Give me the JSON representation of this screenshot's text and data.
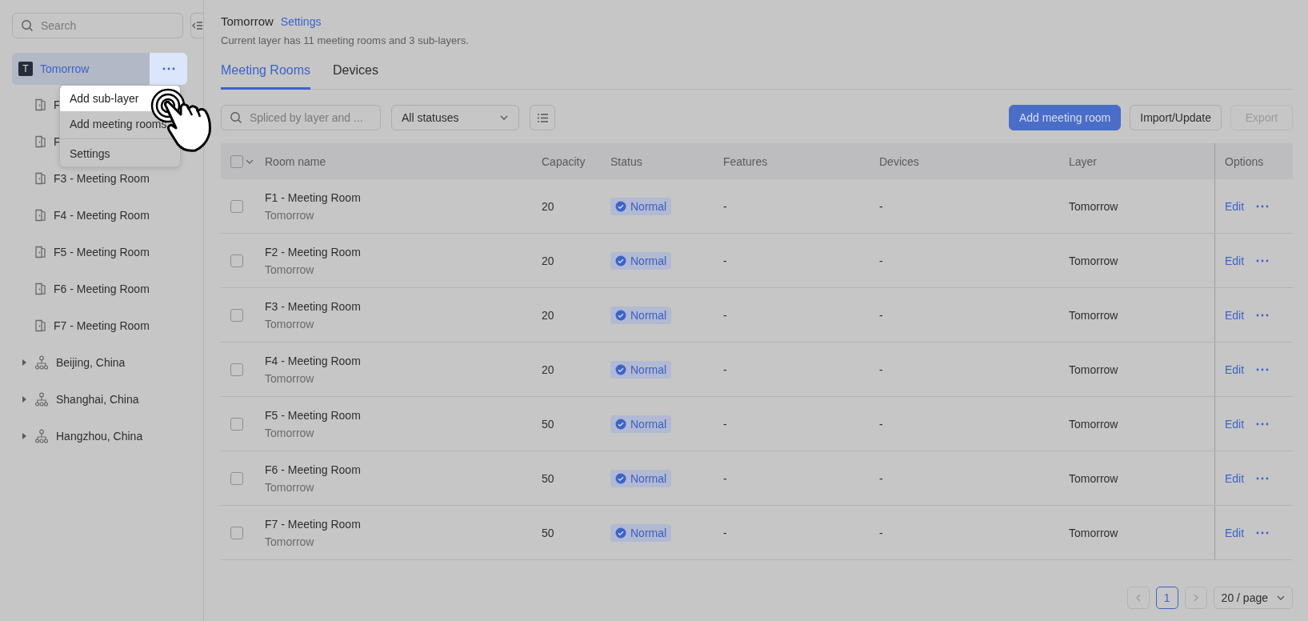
{
  "sidebar": {
    "search": {
      "placeholder": "Search"
    },
    "tree": [
      {
        "label": "Tomorrow",
        "badge": "T",
        "kind": "layer",
        "selected": true,
        "expanded": true,
        "children": [
          {
            "label": "F",
            "kind": "room"
          },
          {
            "label": "F",
            "kind": "room"
          },
          {
            "label": "F3 - Meeting Room",
            "kind": "room"
          },
          {
            "label": "F4 - Meeting Room",
            "kind": "room"
          },
          {
            "label": "F5 - Meeting Room",
            "kind": "room"
          },
          {
            "label": "F6 - Meeting Room",
            "kind": "room"
          },
          {
            "label": "F7 - Meeting Room",
            "kind": "room"
          }
        ]
      },
      {
        "label": "Beijing, China",
        "kind": "group",
        "selected": false,
        "expanded": false
      },
      {
        "label": "Shanghai, China",
        "kind": "group",
        "selected": false,
        "expanded": false
      },
      {
        "label": "Hangzhou, China",
        "kind": "group",
        "selected": false,
        "expanded": false
      }
    ]
  },
  "context_menu": {
    "items": [
      {
        "label": "Add sub-layer",
        "selected": true
      },
      {
        "label": "Add meeting rooms",
        "selected": false
      },
      {
        "label": "Settings",
        "selected": false
      }
    ]
  },
  "header": {
    "title": "Tomorrow",
    "settings_link": "Settings",
    "summary": "Current layer has 11 meeting rooms and 3 sub-layers."
  },
  "tabs": [
    {
      "label": "Meeting Rooms",
      "selected": true
    },
    {
      "label": "Devices",
      "selected": false
    }
  ],
  "toolbar": {
    "search": {
      "placeholder": "Spliced by layer and ..."
    },
    "status_filter": "All statuses",
    "buttons": [
      {
        "label": "Add meeting room",
        "kind": "primary",
        "disabled": false
      },
      {
        "label": "Import/Update",
        "kind": "default",
        "disabled": false
      },
      {
        "label": "Export",
        "kind": "default",
        "disabled": true
      }
    ]
  },
  "table": {
    "all_checked": false,
    "columns": [
      "Room name",
      "Capacity",
      "Status",
      "Features",
      "Devices",
      "Layer",
      "Options"
    ],
    "rows": [
      {
        "checked": false,
        "name": "F1 - Meeting Room",
        "layer_path": "Tomorrow",
        "capacity": "20",
        "status": "Normal",
        "features": "-",
        "devices": "-",
        "layer": "Tomorrow",
        "action": "Edit"
      },
      {
        "checked": false,
        "name": "F2 - Meeting Room",
        "layer_path": "Tomorrow",
        "capacity": "20",
        "status": "Normal",
        "features": "-",
        "devices": "-",
        "layer": "Tomorrow",
        "action": "Edit"
      },
      {
        "checked": false,
        "name": "F3 - Meeting Room",
        "layer_path": "Tomorrow",
        "capacity": "20",
        "status": "Normal",
        "features": "-",
        "devices": "-",
        "layer": "Tomorrow",
        "action": "Edit"
      },
      {
        "checked": false,
        "name": "F4 - Meeting Room",
        "layer_path": "Tomorrow",
        "capacity": "20",
        "status": "Normal",
        "features": "-",
        "devices": "-",
        "layer": "Tomorrow",
        "action": "Edit"
      },
      {
        "checked": false,
        "name": "F5 - Meeting Room",
        "layer_path": "Tomorrow",
        "capacity": "50",
        "status": "Normal",
        "features": "-",
        "devices": "-",
        "layer": "Tomorrow",
        "action": "Edit"
      },
      {
        "checked": false,
        "name": "F6 - Meeting Room",
        "layer_path": "Tomorrow",
        "capacity": "50",
        "status": "Normal",
        "features": "-",
        "devices": "-",
        "layer": "Tomorrow",
        "action": "Edit"
      },
      {
        "checked": false,
        "name": "F7 - Meeting Room",
        "layer_path": "Tomorrow",
        "capacity": "50",
        "status": "Normal",
        "features": "-",
        "devices": "-",
        "layer": "Tomorrow",
        "action": "Edit"
      }
    ]
  },
  "pagination": {
    "pages": [
      {
        "label": "1",
        "selected": true
      }
    ],
    "page_size": "20 / page"
  }
}
